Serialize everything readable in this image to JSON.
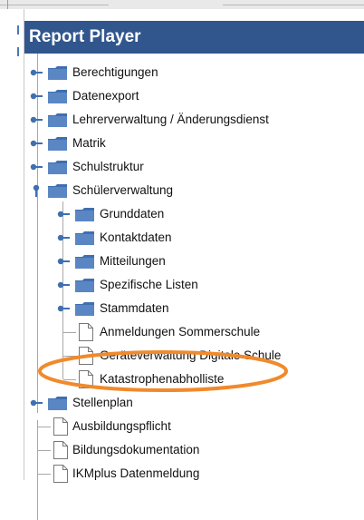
{
  "window": {
    "title": "Report Player"
  },
  "tree": {
    "items": [
      {
        "label": "Berechtigungen",
        "type": "folder"
      },
      {
        "label": "Datenexport",
        "type": "folder"
      },
      {
        "label": "Lehrerverwaltung / Änderungsdienst",
        "type": "folder"
      },
      {
        "label": "Matrik",
        "type": "folder"
      },
      {
        "label": "Schulstruktur",
        "type": "folder"
      },
      {
        "label": "Schülerverwaltung",
        "type": "folder",
        "expanded": true
      },
      {
        "label": "Grunddaten",
        "type": "folder"
      },
      {
        "label": "Kontaktdaten",
        "type": "folder"
      },
      {
        "label": "Mitteilungen",
        "type": "folder"
      },
      {
        "label": "Spezifische Listen",
        "type": "folder"
      },
      {
        "label": "Stammdaten",
        "type": "folder"
      },
      {
        "label": "Anmeldungen Sommerschule",
        "type": "report"
      },
      {
        "label": "Geräteverwaltung Digitale Schule",
        "type": "report"
      },
      {
        "label": "Katastrophenabholliste",
        "type": "report",
        "highlighted": true
      },
      {
        "label": "Stellenplan",
        "type": "folder"
      },
      {
        "label": "Ausbildungspflicht",
        "type": "report"
      },
      {
        "label": "Bildungsdokumentation",
        "type": "report"
      },
      {
        "label": "IKMplus Datenmeldung",
        "type": "report"
      }
    ]
  },
  "colors": {
    "header_bg": "#31568e",
    "folder": "#3f6fb0",
    "highlight": "#f08a2c"
  },
  "icons": {
    "expander": "expander-pin-icon",
    "folder": "folder-icon",
    "report": "document-icon"
  }
}
